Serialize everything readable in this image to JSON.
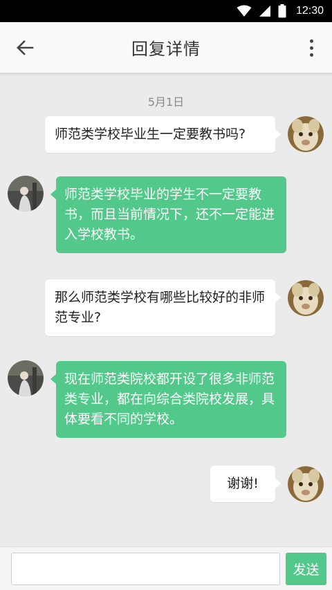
{
  "status_bar": {
    "time": "12:30"
  },
  "header": {
    "title": "回复详情"
  },
  "chat": {
    "date": "5月1日",
    "messages": [
      {
        "side": "out",
        "text": "师范类学校毕业生一定要教书吗?"
      },
      {
        "side": "in",
        "text": "师范类学校毕业的学生不一定要教书，而且当前情况下，还不一定能进入学校教书。"
      },
      {
        "side": "out",
        "text": "那么师范类学校有哪些比较好的非师范专业?"
      },
      {
        "side": "in",
        "text": "现在师范类院校都开设了很多非师范类专业，都在向综合类院校发展，具体要看不同的学校。"
      },
      {
        "side": "out",
        "text": "谢谢!"
      }
    ]
  },
  "input": {
    "value": "",
    "placeholder": "",
    "send_label": "发送"
  },
  "colors": {
    "accent": "#52c98a",
    "background": "#ebebeb"
  }
}
